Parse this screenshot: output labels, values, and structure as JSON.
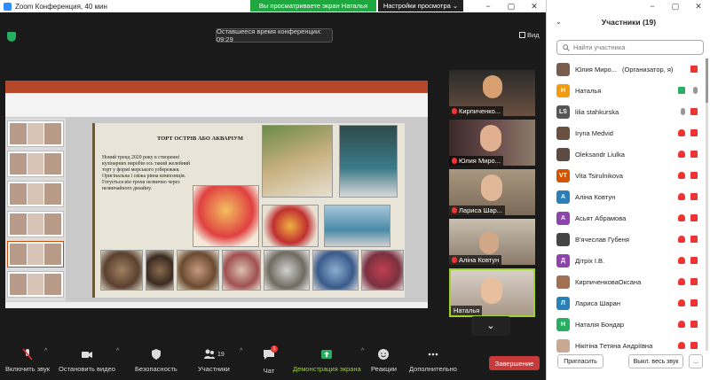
{
  "window": {
    "title": "Zoom Конференция, 40 мин",
    "share_banner": "Вы просматриваете экран Наталья",
    "view_options": "Настройки просмотра ⌄"
  },
  "meeting": {
    "timer": "Оставшееся время конференции: 09:29",
    "view": "Вид"
  },
  "slide": {
    "title": "ТОРТ ОСТРІВ АБО АКВАРІУМ",
    "text": "Новий тренд 2020 року в створенні кулінарних виробів ось такий желейний торт у формі морського узбережжя. Оригінальна і свіжа рівна композиція. Готується він трохи незвично через незвичайного дизайну."
  },
  "video_tiles": [
    {
      "name": "Кирпиченко...",
      "muted": true
    },
    {
      "name": "Юлия Миро...",
      "muted": true
    },
    {
      "name": "Лариса Шар...",
      "muted": true
    },
    {
      "name": "Аліна Ковтун",
      "muted": true
    },
    {
      "name": "Наталья",
      "muted": false
    }
  ],
  "toolbar": {
    "unmute": "Включить звук",
    "stop_video": "Остановить видео",
    "security": "Безопасность",
    "participants": "Участники",
    "participants_count": "19",
    "chat": "Чат",
    "chat_badge": "1",
    "share": "Демонстрация экрана",
    "reactions": "Реакции",
    "more": "Дополнительно",
    "end": "Завершение"
  },
  "panel": {
    "title": "Участники (19)",
    "search_placeholder": "Найти участника",
    "participants": [
      {
        "name": "Юлия Миро...",
        "role": "(Организатор, я)",
        "initial": "",
        "color": "#7a5c4a",
        "photo": true,
        "mic": "on"
      },
      {
        "name": "Наталья",
        "initial": "Н",
        "color": "#f39c12",
        "photo": false,
        "mic": "on",
        "video": "on"
      },
      {
        "name": "lilia stahkurska",
        "initial": "LS",
        "color": "#555",
        "photo": false,
        "mic": "off_plain"
      },
      {
        "name": "Iryna Medvid",
        "initial": "",
        "color": "#6a5040",
        "photo": true,
        "mic": "muted"
      },
      {
        "name": "Oleksandr Liulka",
        "initial": "",
        "color": "#5b4b40",
        "photo": true,
        "mic": "muted"
      },
      {
        "name": "Vita Tsirulnikova",
        "initial": "VT",
        "color": "#d35400",
        "photo": false,
        "mic": "muted"
      },
      {
        "name": "Аліна Ковтун",
        "initial": "А",
        "color": "#2980b9",
        "photo": false,
        "mic": "muted"
      },
      {
        "name": "Асьят Абрамова",
        "initial": "А",
        "color": "#8e44ad",
        "photo": false,
        "mic": "muted"
      },
      {
        "name": "В'ячеслав Губеня",
        "initial": "",
        "color": "#444",
        "photo": true,
        "mic": "muted"
      },
      {
        "name": "Дітріх І.В.",
        "initial": "Д",
        "color": "#8e44ad",
        "photo": false,
        "mic": "muted"
      },
      {
        "name": "КирпиченковаОксана",
        "initial": "",
        "color": "#a07050",
        "photo": true,
        "mic": "muted"
      },
      {
        "name": "Лариса Шаран",
        "initial": "Л",
        "color": "#2980b9",
        "photo": false,
        "mic": "muted"
      },
      {
        "name": "Наталія Бондар",
        "initial": "Н",
        "color": "#27ae60",
        "photo": false,
        "mic": "muted"
      },
      {
        "name": "Нікітіна Тетяна Андріївна",
        "initial": "",
        "color": "#c8a890",
        "photo": true,
        "mic": "muted"
      }
    ],
    "invite": "Пригласить",
    "mute_all": "Выкл. весь звук",
    "more": "..."
  }
}
